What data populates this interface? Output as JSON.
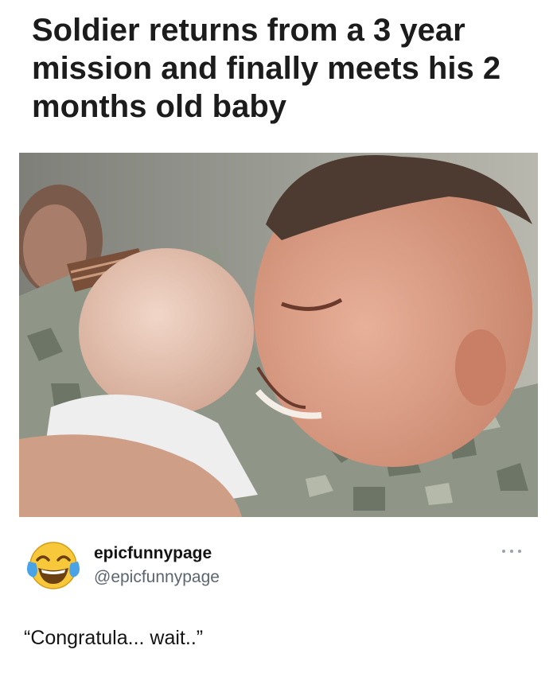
{
  "post": {
    "headline": "Soldier returns from a 3 year mission and finally meets his 2 months old baby",
    "photo_icon": "photo-of-soldier-hugging-baby"
  },
  "tweet": {
    "avatar_icon": "tears-of-joy-emoji-icon",
    "display_name": "epicfunnypage",
    "handle": "@epicfunnypage",
    "more_icon": "more-options-icon",
    "text": "“Congratula... wait..”"
  },
  "colors": {
    "text": "#141414",
    "handle": "#5c6670",
    "background": "#ffffff"
  }
}
